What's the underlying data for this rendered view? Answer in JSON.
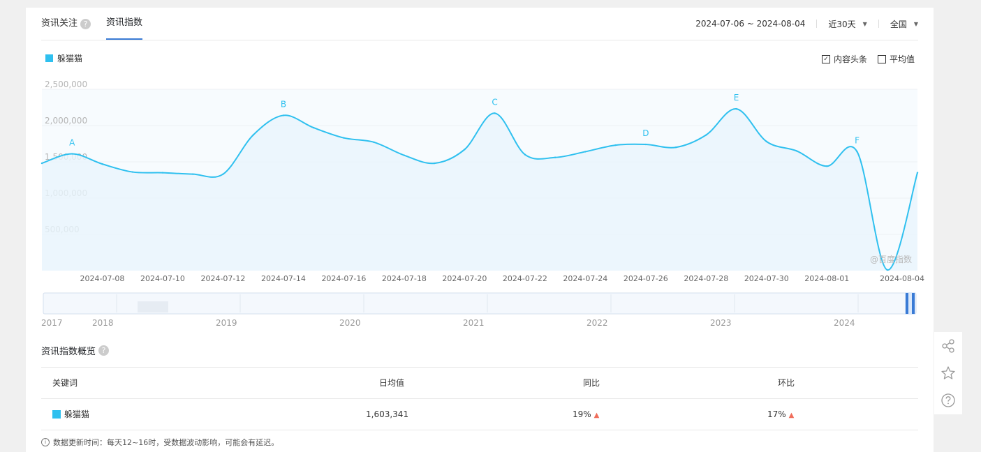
{
  "tabs": [
    {
      "label": "资讯关注",
      "help": "?"
    },
    {
      "label": "资讯指数"
    }
  ],
  "date_range": "2024-07-06 ~ 2024-08-04",
  "period": "近30天",
  "region": "全国",
  "legend": {
    "label": "躲猫猫",
    "color": "#2fc0ef"
  },
  "options": [
    {
      "label": "内容头条",
      "checked": true
    },
    {
      "label": "平均值",
      "checked": false
    }
  ],
  "watermark": "@百度指数",
  "chart_data": {
    "type": "area",
    "title": "",
    "xlabel": "",
    "ylabel": "",
    "ylim": [
      0,
      2500000
    ],
    "yticks": [
      "2,500,000",
      "2,000,000",
      "1,500,000",
      "1,000,000",
      "500,000"
    ],
    "xtick_labels": [
      "2024-07-08",
      "2024-07-10",
      "2024-07-12",
      "2024-07-14",
      "2024-07-16",
      "2024-07-18",
      "2024-07-20",
      "2024-07-22",
      "2024-07-24",
      "2024-07-26",
      "2024-07-28",
      "2024-07-30",
      "2024-08-01",
      "2024-08-04"
    ],
    "series": [
      {
        "name": "躲猫猫",
        "color": "#2fc0ef",
        "x": [
          "2024-07-06",
          "2024-07-07",
          "2024-07-08",
          "2024-07-09",
          "2024-07-10",
          "2024-07-11",
          "2024-07-12",
          "2024-07-13",
          "2024-07-14",
          "2024-07-15",
          "2024-07-16",
          "2024-07-17",
          "2024-07-18",
          "2024-07-19",
          "2024-07-20",
          "2024-07-21",
          "2024-07-22",
          "2024-07-23",
          "2024-07-24",
          "2024-07-25",
          "2024-07-26",
          "2024-07-27",
          "2024-07-28",
          "2024-07-29",
          "2024-07-30",
          "2024-07-31",
          "2024-08-01",
          "2024-08-02",
          "2024-08-03",
          "2024-08-04"
        ],
        "values": [
          1480000,
          1610000,
          1470000,
          1360000,
          1350000,
          1330000,
          1330000,
          1870000,
          2140000,
          1970000,
          1830000,
          1770000,
          1590000,
          1480000,
          1670000,
          2170000,
          1600000,
          1560000,
          1640000,
          1730000,
          1740000,
          1700000,
          1870000,
          2230000,
          1780000,
          1650000,
          1440000,
          1640000,
          10000,
          1350000
        ]
      }
    ],
    "annotations": [
      {
        "label": "A",
        "x": "2024-07-07"
      },
      {
        "label": "B",
        "x": "2024-07-14"
      },
      {
        "label": "C",
        "x": "2024-07-21"
      },
      {
        "label": "D",
        "x": "2024-07-26"
      },
      {
        "label": "E",
        "x": "2024-07-29"
      },
      {
        "label": "F",
        "x": "2024-08-02"
      }
    ],
    "grid": true,
    "legend_position": "top-left"
  },
  "timeline": {
    "years": [
      "2017",
      "2018",
      "2019",
      "2020",
      "2021",
      "2022",
      "2023",
      "2024"
    ]
  },
  "overview": {
    "title": "资讯指数概览",
    "help": "?",
    "headers": [
      "关键词",
      "日均值",
      "同比",
      "环比"
    ],
    "rows": [
      {
        "keyword": "躲猫猫",
        "avg": "1,603,341",
        "yoy": "19%",
        "mom": "17%",
        "color": "#2fc0ef"
      }
    ]
  },
  "note": "数据更新时间：每天12~16时，受数据波动影响，可能会有延迟。",
  "icons": {
    "check": "✓",
    "up": "▲",
    "info": "i",
    "caret": "▼"
  }
}
